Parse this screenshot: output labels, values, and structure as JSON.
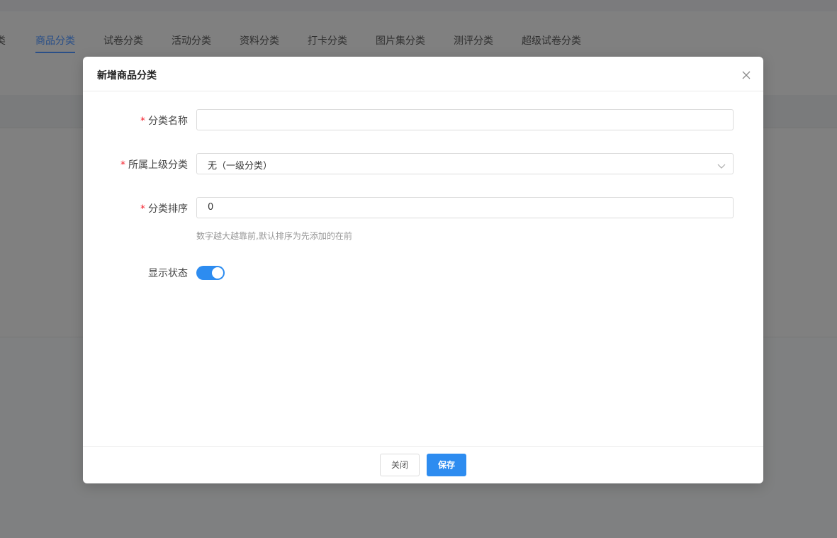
{
  "tabs": [
    {
      "label": "类",
      "active": false
    },
    {
      "label": "商品分类",
      "active": true
    },
    {
      "label": "试卷分类",
      "active": false
    },
    {
      "label": "活动分类",
      "active": false
    },
    {
      "label": "资料分类",
      "active": false
    },
    {
      "label": "打卡分类",
      "active": false
    },
    {
      "label": "图片集分类",
      "active": false
    },
    {
      "label": "测评分类",
      "active": false
    },
    {
      "label": "超级试卷分类",
      "active": false
    }
  ],
  "modal": {
    "title": "新增商品分类",
    "close_icon": "close-icon",
    "required_mark": "*",
    "fields": {
      "name": {
        "label": "分类名称",
        "required": true,
        "value": ""
      },
      "parent": {
        "label": "所属上级分类",
        "required": true,
        "value": "无（一级分类）",
        "icon": "chevron-down-icon"
      },
      "sort": {
        "label": "分类排序",
        "required": true,
        "value": "0",
        "hint": "数字越大越靠前,默认排序为先添加的在前"
      },
      "status": {
        "label": "显示状态",
        "enabled": true
      }
    },
    "footer": {
      "close_label": "关闭",
      "save_label": "保存"
    }
  },
  "colors": {
    "primary": "#2d8cf0",
    "required": "#f5222d",
    "active_tab": "#2a4f88"
  }
}
